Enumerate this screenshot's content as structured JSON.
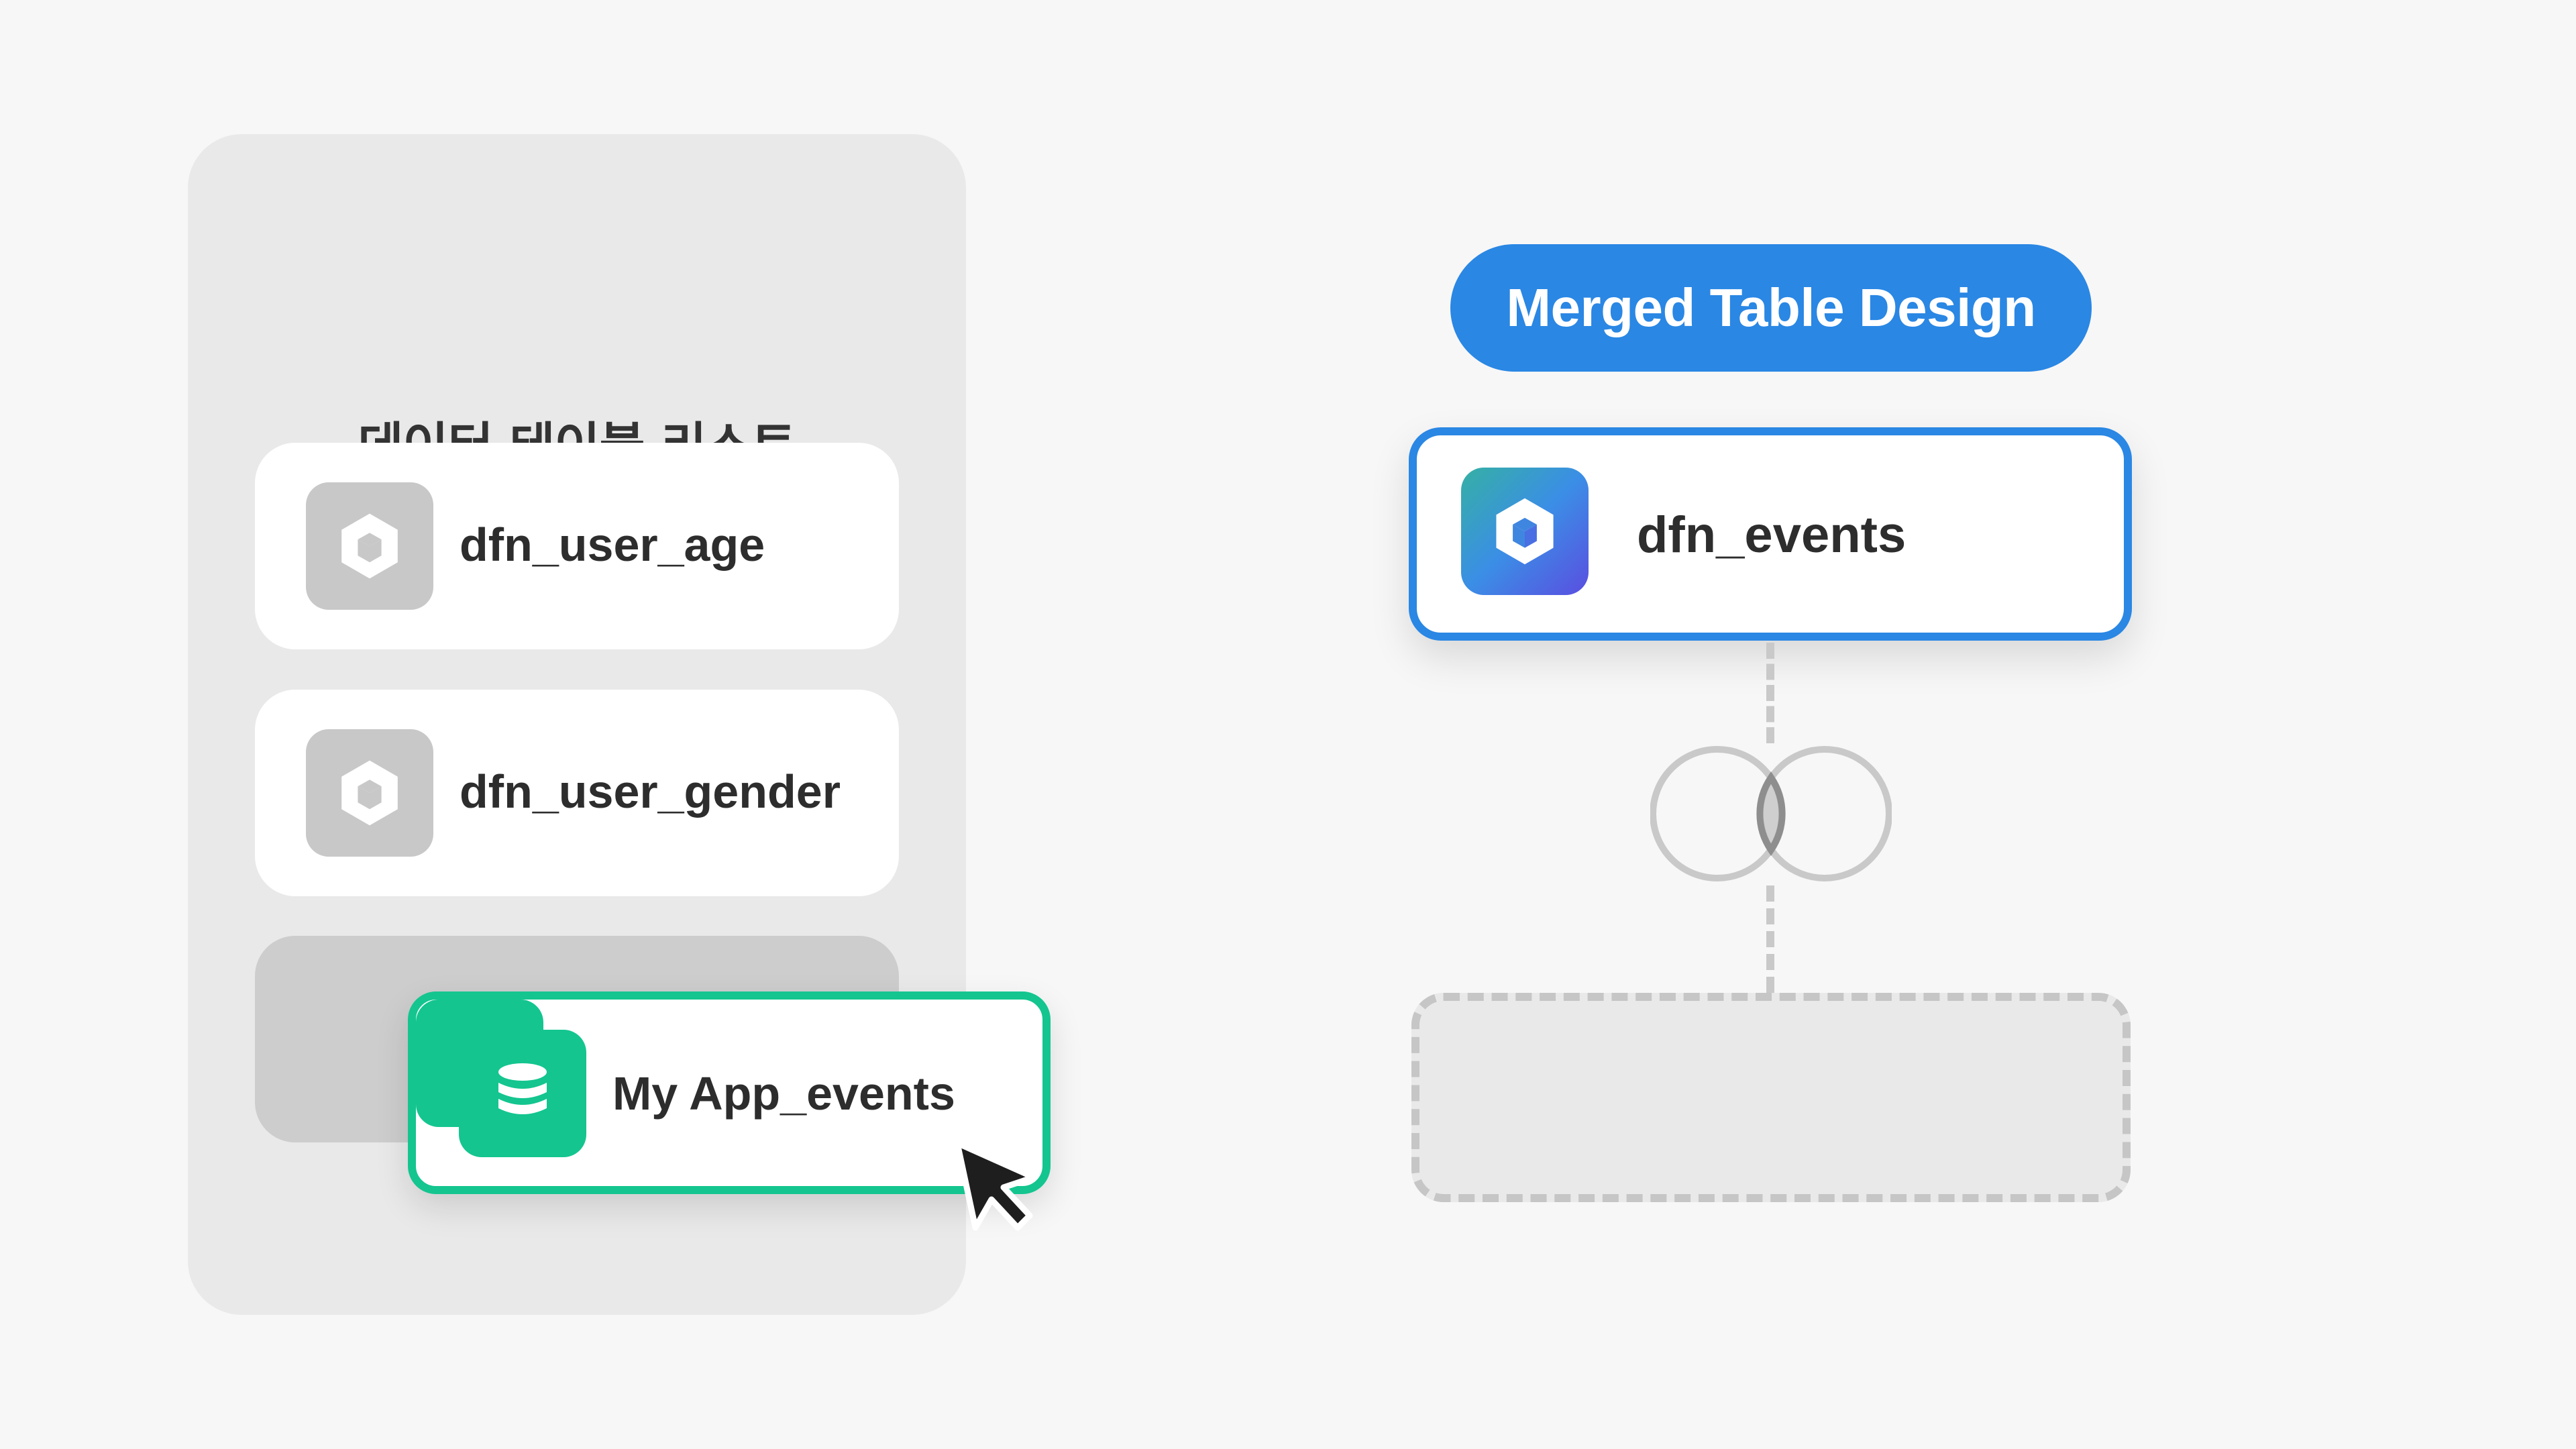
{
  "data_table_list": {
    "title": "데이터 테이블 리스트",
    "items": [
      {
        "label": "dfn_user_age",
        "icon": "cube-icon"
      },
      {
        "label": "dfn_user_gender",
        "icon": "cube-icon"
      }
    ]
  },
  "dragged_item": {
    "label": "My App_events",
    "icon": "database-icon"
  },
  "merged_design": {
    "title": "Merged Table Design",
    "table": {
      "label": "dfn_events",
      "icon": "cube-icon"
    },
    "join_icon": "venn-join-icon"
  },
  "colors": {
    "accent_blue": "#2a87e4",
    "accent_green": "#14c58f",
    "panel_gray": "#e9e9e9"
  }
}
